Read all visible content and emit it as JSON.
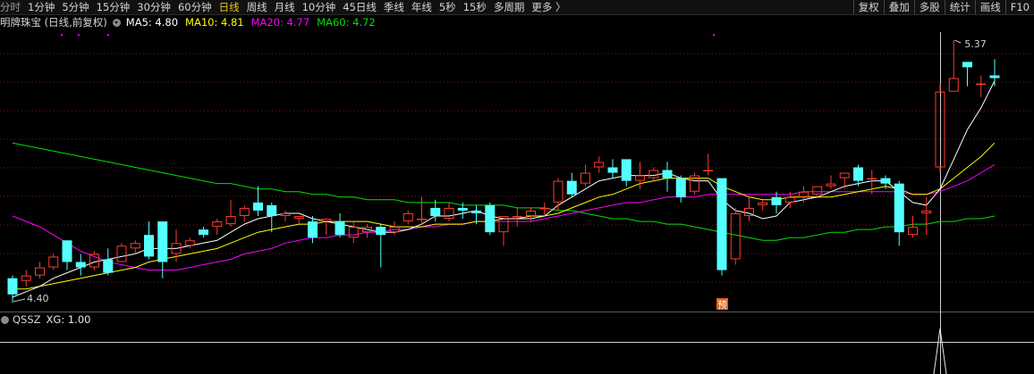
{
  "toolbar": {
    "periods": [
      "分时",
      "1分钟",
      "5分钟",
      "15分钟",
      "30分钟",
      "60分钟",
      "日线",
      "周线",
      "月线",
      "10分钟",
      "45日线",
      "季线",
      "年线",
      "5秒",
      "15秒",
      "多周期",
      "更多 〉"
    ],
    "active_period": "日线",
    "right_buttons": [
      "复权",
      "叠加",
      "多股",
      "统计",
      "画线",
      "F10"
    ]
  },
  "legend": {
    "title": "明牌珠宝 (日线,前复权)",
    "ma5": "MA5: 4.80",
    "ma10": "MA10: 4.81",
    "ma20": "MA20: 4.77",
    "ma60": "MA60: 4.72"
  },
  "colors": {
    "up": "#ff3b30",
    "down": "#54ffff",
    "ma5": "#ffffff",
    "ma10": "#ffff00",
    "ma20": "#ff00ff",
    "ma60": "#00e000",
    "grid": "#7a1a1a",
    "background": "#000000"
  },
  "price_chart": {
    "high_label": "5.37",
    "low_label": "4.40",
    "marker_label": "预",
    "grid": true,
    "candles": [
      [
        4.49,
        4.43,
        4.5,
        4.4
      ],
      [
        4.48,
        4.5,
        4.52,
        4.46
      ],
      [
        4.5,
        4.53,
        4.55,
        4.49
      ],
      [
        4.53,
        4.57,
        4.58,
        4.52
      ],
      [
        4.63,
        4.55,
        4.63,
        4.52
      ],
      [
        4.55,
        4.53,
        4.58,
        4.5
      ],
      [
        4.53,
        4.58,
        4.59,
        4.52
      ],
      [
        4.56,
        4.51,
        4.6,
        4.5
      ],
      [
        4.55,
        4.61,
        4.62,
        4.55
      ],
      [
        4.6,
        4.62,
        4.63,
        4.58
      ],
      [
        4.65,
        4.57,
        4.7,
        4.56
      ],
      [
        4.7,
        4.55,
        4.7,
        4.49
      ],
      [
        4.58,
        4.62,
        4.67,
        4.55
      ],
      [
        4.61,
        4.63,
        4.64,
        4.6
      ],
      [
        4.67,
        4.65,
        4.68,
        4.64
      ],
      [
        4.68,
        4.7,
        4.71,
        4.65
      ],
      [
        4.69,
        4.72,
        4.78,
        4.68
      ],
      [
        4.72,
        4.75,
        4.76,
        4.7
      ],
      [
        4.77,
        4.74,
        4.83,
        4.72
      ],
      [
        4.76,
        4.72,
        4.77,
        4.66
      ],
      [
        4.72,
        4.73,
        4.74,
        4.7
      ],
      [
        4.71,
        4.72,
        4.72,
        4.69
      ],
      [
        4.7,
        4.64,
        4.72,
        4.62
      ],
      [
        4.7,
        4.71,
        4.71,
        4.65
      ],
      [
        4.7,
        4.65,
        4.73,
        4.64
      ],
      [
        4.64,
        4.68,
        4.7,
        4.62
      ],
      [
        4.66,
        4.68,
        4.69,
        4.64
      ],
      [
        4.68,
        4.65,
        4.69,
        4.53
      ],
      [
        4.66,
        4.68,
        4.7,
        4.65
      ],
      [
        4.7,
        4.73,
        4.74,
        4.69
      ],
      [
        4.71,
        4.71,
        4.79,
        4.69
      ],
      [
        4.75,
        4.72,
        4.78,
        4.7
      ],
      [
        4.71,
        4.75,
        4.77,
        4.7
      ],
      [
        4.75,
        4.74,
        4.77,
        4.71
      ],
      [
        4.74,
        4.73,
        4.76,
        4.69
      ],
      [
        4.76,
        4.66,
        4.77,
        4.65
      ],
      [
        4.66,
        4.72,
        4.72,
        4.61
      ],
      [
        4.72,
        4.72,
        4.75,
        4.68
      ],
      [
        4.72,
        4.74,
        4.75,
        4.7
      ],
      [
        4.75,
        4.75,
        4.77,
        4.72
      ],
      [
        4.77,
        4.85,
        4.86,
        4.74
      ],
      [
        4.85,
        4.8,
        4.88,
        4.79
      ],
      [
        4.84,
        4.88,
        4.91,
        4.83
      ],
      [
        4.9,
        4.92,
        4.94,
        4.88
      ],
      [
        4.9,
        4.88,
        4.93,
        4.86
      ],
      [
        4.93,
        4.85,
        4.93,
        4.83
      ],
      [
        4.85,
        4.87,
        4.92,
        4.82
      ],
      [
        4.86,
        4.89,
        4.9,
        4.85
      ],
      [
        4.89,
        4.86,
        4.92,
        4.81
      ],
      [
        4.86,
        4.79,
        4.87,
        4.77
      ],
      [
        4.81,
        4.87,
        4.88,
        4.8
      ],
      [
        4.89,
        4.89,
        4.95,
        4.87
      ],
      [
        4.86,
        4.52,
        4.86,
        4.5
      ],
      [
        4.56,
        4.73,
        4.75,
        4.54
      ],
      [
        4.72,
        4.75,
        4.79,
        4.7
      ],
      [
        4.76,
        4.77,
        4.78,
        4.74
      ],
      [
        4.79,
        4.76,
        4.81,
        4.73
      ],
      [
        4.77,
        4.79,
        4.81,
        4.75
      ],
      [
        4.79,
        4.81,
        4.83,
        4.77
      ],
      [
        4.8,
        4.83,
        4.83,
        4.79
      ],
      [
        4.83,
        4.84,
        4.87,
        4.82
      ],
      [
        4.86,
        4.88,
        4.88,
        4.82
      ],
      [
        4.9,
        4.85,
        4.91,
        4.83
      ],
      [
        4.86,
        4.86,
        4.89,
        4.8
      ],
      [
        4.86,
        4.84,
        4.87,
        4.82
      ],
      [
        4.84,
        4.66,
        4.85,
        4.61
      ],
      [
        4.65,
        4.68,
        4.72,
        4.64
      ],
      [
        4.73,
        4.74,
        4.79,
        4.65
      ],
      [
        4.9,
        5.18,
        5.21,
        4.88
      ],
      [
        5.18,
        5.23,
        5.37,
        5.18
      ],
      [
        5.29,
        5.27,
        5.29,
        5.2
      ],
      [
        5.21,
        5.21,
        5.24,
        5.16
      ],
      [
        5.24,
        5.23,
        5.3,
        5.2
      ]
    ],
    "ma5": [
      4.42,
      4.44,
      4.46,
      4.49,
      4.51,
      4.53,
      4.55,
      4.56,
      4.57,
      4.58,
      4.6,
      4.6,
      4.6,
      4.61,
      4.62,
      4.63,
      4.66,
      4.69,
      4.71,
      4.72,
      4.73,
      4.73,
      4.71,
      4.7,
      4.69,
      4.68,
      4.67,
      4.66,
      4.66,
      4.67,
      4.69,
      4.72,
      4.72,
      4.73,
      4.74,
      4.72,
      4.71,
      4.71,
      4.71,
      4.72,
      4.76,
      4.79,
      4.82,
      4.85,
      4.86,
      4.87,
      4.87,
      4.87,
      4.88,
      4.86,
      4.85,
      4.85,
      4.78,
      4.74,
      4.73,
      4.71,
      4.72,
      4.77,
      4.78,
      4.79,
      4.81,
      4.83,
      4.84,
      4.85,
      4.85,
      4.81,
      4.77,
      4.76,
      4.82,
      4.93,
      5.04,
      5.12,
      5.22
    ],
    "ma10": [
      4.45,
      4.45,
      4.46,
      4.47,
      4.48,
      4.49,
      4.5,
      4.51,
      4.52,
      4.53,
      4.55,
      4.56,
      4.57,
      4.58,
      4.59,
      4.6,
      4.62,
      4.64,
      4.66,
      4.67,
      4.68,
      4.69,
      4.69,
      4.7,
      4.7,
      4.7,
      4.7,
      4.69,
      4.68,
      4.68,
      4.68,
      4.69,
      4.69,
      4.69,
      4.7,
      4.7,
      4.71,
      4.71,
      4.72,
      4.72,
      4.73,
      4.75,
      4.77,
      4.79,
      4.8,
      4.82,
      4.84,
      4.85,
      4.86,
      4.86,
      4.86,
      4.86,
      4.83,
      4.81,
      4.79,
      4.78,
      4.78,
      4.79,
      4.79,
      4.79,
      4.79,
      4.8,
      4.81,
      4.82,
      4.83,
      4.82,
      4.8,
      4.8,
      4.82,
      4.86,
      4.9,
      4.94,
      4.99
    ],
    "ma20": [
      4.72,
      4.7,
      4.68,
      4.65,
      4.62,
      4.59,
      4.57,
      4.55,
      4.54,
      4.53,
      4.52,
      4.52,
      4.52,
      4.53,
      4.54,
      4.55,
      4.56,
      4.58,
      4.59,
      4.6,
      4.62,
      4.63,
      4.64,
      4.64,
      4.65,
      4.65,
      4.66,
      4.66,
      4.67,
      4.67,
      4.68,
      4.68,
      4.69,
      4.69,
      4.7,
      4.7,
      4.7,
      4.7,
      4.7,
      4.71,
      4.72,
      4.73,
      4.74,
      4.75,
      4.76,
      4.77,
      4.77,
      4.78,
      4.79,
      4.79,
      4.79,
      4.8,
      4.8,
      4.8,
      4.8,
      4.8,
      4.8,
      4.8,
      4.81,
      4.81,
      4.81,
      4.81,
      4.81,
      4.81,
      4.81,
      4.81,
      4.8,
      4.8,
      4.81,
      4.83,
      4.85,
      4.88,
      4.91
    ],
    "ma60": [
      4.99,
      4.98,
      4.97,
      4.96,
      4.95,
      4.94,
      4.93,
      4.92,
      4.91,
      4.9,
      4.89,
      4.88,
      4.87,
      4.86,
      4.85,
      4.84,
      4.84,
      4.83,
      4.82,
      4.82,
      4.81,
      4.81,
      4.8,
      4.8,
      4.79,
      4.79,
      4.78,
      4.78,
      4.78,
      4.77,
      4.77,
      4.77,
      4.77,
      4.76,
      4.76,
      4.76,
      4.76,
      4.75,
      4.75,
      4.75,
      4.74,
      4.74,
      4.73,
      4.72,
      4.71,
      4.71,
      4.7,
      4.7,
      4.69,
      4.69,
      4.68,
      4.67,
      4.66,
      4.65,
      4.64,
      4.63,
      4.63,
      4.64,
      4.64,
      4.65,
      4.66,
      4.66,
      4.67,
      4.67,
      4.68,
      4.68,
      4.69,
      4.69,
      4.7,
      4.7,
      4.71,
      4.71,
      4.72
    ]
  },
  "sub_chart": {
    "name": "QSSZ",
    "xg": "XG: 1.00",
    "signal_index": 68,
    "signal_value": 1.0
  }
}
